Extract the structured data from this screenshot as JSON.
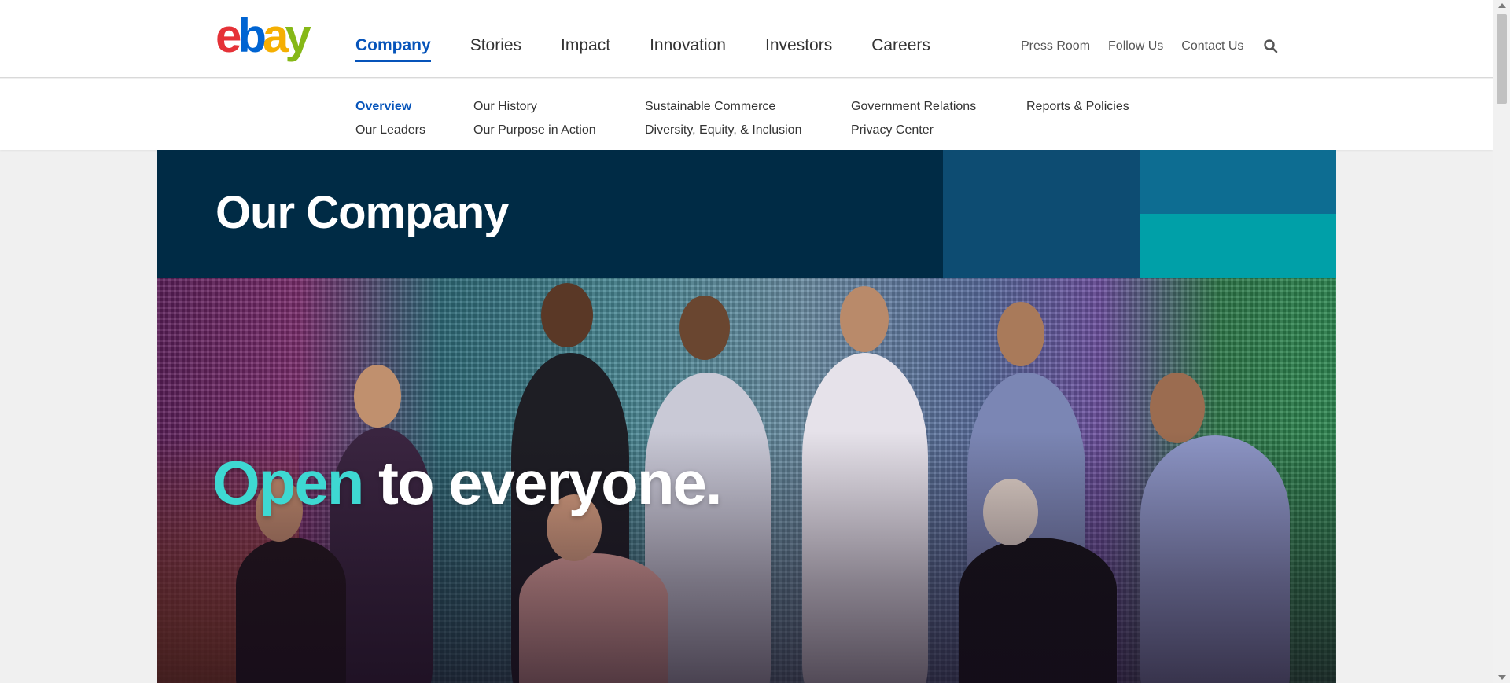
{
  "header": {
    "logo_alt": "ebay",
    "primary_nav": [
      {
        "label": "Company",
        "active": true
      },
      {
        "label": "Stories",
        "active": false
      },
      {
        "label": "Impact",
        "active": false
      },
      {
        "label": "Innovation",
        "active": false
      },
      {
        "label": "Investors",
        "active": false
      },
      {
        "label": "Careers",
        "active": false
      }
    ],
    "utility_nav": [
      "Press Room",
      "Follow Us",
      "Contact Us"
    ],
    "search_icon": "search-icon"
  },
  "subnav": {
    "columns": [
      [
        "Overview",
        "Our Leaders"
      ],
      [
        "Our History",
        "Our Purpose in Action"
      ],
      [
        "Sustainable Commerce",
        "Diversity, Equity, & Inclusion"
      ],
      [
        "Government Relations",
        "Privacy Center"
      ],
      [
        "Reports & Policies"
      ]
    ],
    "active": "Overview"
  },
  "hero": {
    "title": "Our Company",
    "tagline_accent": "Open",
    "tagline_rest": " to everyone."
  },
  "colors": {
    "brand_blue": "#0654ba",
    "hero_navy": "#002b45",
    "hero_block_1": "#0d4c72",
    "hero_block_2": "#0d6d92",
    "hero_block_3": "#00a0a8",
    "tagline_accent": "#3ed8d2",
    "logo_e": "#e53238",
    "logo_b": "#0064d2",
    "logo_a": "#f5af02",
    "logo_y": "#86b817"
  }
}
